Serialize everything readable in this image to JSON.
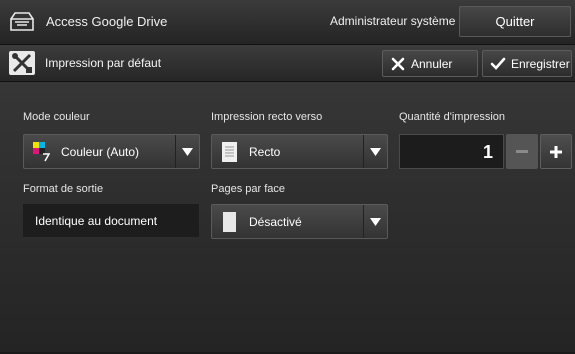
{
  "header": {
    "title": "Access Google Drive",
    "admin_label": "Administrateur système",
    "quit_label": "Quitter",
    "icon": "drive-icon"
  },
  "subheader": {
    "label": "Impression par défaut",
    "icon": "tools-icon",
    "cancel_label": "Annuler",
    "save_label": "Enregistrer"
  },
  "settings": {
    "color_mode": {
      "label": "Mode couleur",
      "value": "Couleur (Auto)",
      "icon": "color-auto-icon"
    },
    "duplex": {
      "label": "Impression recto verso",
      "value": "Recto",
      "icon": "page-icon"
    },
    "quantity": {
      "label": "Quantité d'impression",
      "value": "1"
    },
    "output_format": {
      "label": "Format de sortie",
      "value": "Identique au document"
    },
    "pages_per_side": {
      "label": "Pages par face",
      "value": "Désactivé",
      "icon": "single-page-icon"
    }
  }
}
